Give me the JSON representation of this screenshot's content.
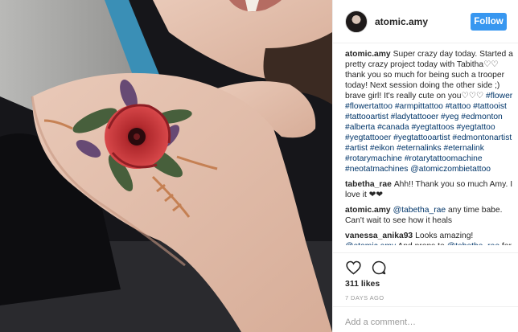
{
  "post": {
    "username": "atomic.amy",
    "follow_label": "Follow"
  },
  "comments": [
    {
      "author": "atomic.amy",
      "segments": [
        {
          "text": "Super crazy day today. Started a pretty crazy project today with Tabitha♡♡ thank you so much for being such a trooper today! Next session doing the other side ;) brave girl! It's really cute on you♡♡♡ "
        },
        {
          "text": "#flower #flowertattoo #armpittattoo #tattoo #tattooist #tattooartist #ladytattooer #yeg #edmonton #alberta #canada #yegtattoos #yegtattoo #yegtattooer #yegtattooartist #edmontonartist #artist #eikon #eternalinks #eternalink #rotarymachine #rotarytattoomachine #neotatmachines @atomiczombietattoo",
          "tag": true
        }
      ]
    },
    {
      "author": "tabetha_rae",
      "segments": [
        {
          "text": "Ahh!! Thank you so much Amy. I love it ❤❤"
        }
      ]
    },
    {
      "author": "atomic.amy",
      "segments": [
        {
          "text": "@tabetha_rae",
          "tag": true
        },
        {
          "text": " any time babe. Can't wait to see how it heals"
        }
      ]
    },
    {
      "author": "vanessa_anika93",
      "segments": [
        {
          "text": "Looks amazing! "
        },
        {
          "text": "@atomic.amy",
          "tag": true
        },
        {
          "text": " And props to "
        },
        {
          "text": "@tabetha_rae",
          "tag": true
        },
        {
          "text": " for"
        }
      ]
    }
  ],
  "likes": "311 likes",
  "age": "7 DAYS AGO",
  "add_comment": {
    "placeholder": "Add a comment…"
  },
  "icons": {
    "like": "heart-icon",
    "comment": "speech-bubble-icon"
  },
  "colors": {
    "follow_button": "#3897f0",
    "hashtag": "#003569",
    "muted": "#999999"
  }
}
